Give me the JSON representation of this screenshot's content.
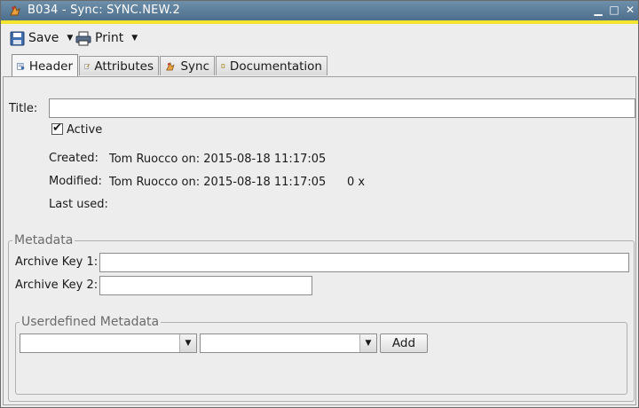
{
  "window": {
    "title": "B034 - Sync: SYNC.NEW.2"
  },
  "toolbar": {
    "save_label": "Save",
    "print_label": "Print"
  },
  "tabs": [
    {
      "label": "Header",
      "icon": "header-icon",
      "active": true
    },
    {
      "label": "Attributes",
      "icon": "attributes-icon",
      "active": false
    },
    {
      "label": "Sync",
      "icon": "sync-icon",
      "active": false
    },
    {
      "label": "Documentation",
      "icon": "documentation-icon",
      "active": false
    }
  ],
  "header": {
    "title_label": "Title:",
    "title_value": "",
    "active_label": "Active",
    "active_checked": true,
    "created_label": "Created:",
    "created_value": "Tom Ruocco on: 2015-08-18 11:17:05",
    "modified_label": "Modified:",
    "modified_value": "Tom Ruocco on: 2015-08-18 11:17:05",
    "modified_count": "0 x",
    "last_used_label": "Last used:"
  },
  "metadata": {
    "legend": "Metadata",
    "archive_key1_label": "Archive Key 1:",
    "archive_key1_value": "",
    "archive_key2_label": "Archive Key 2:",
    "archive_key2_value": ""
  },
  "userdefined": {
    "legend": "Userdefined Metadata",
    "key_value": "",
    "value_value": "",
    "add_label": "Add"
  }
}
